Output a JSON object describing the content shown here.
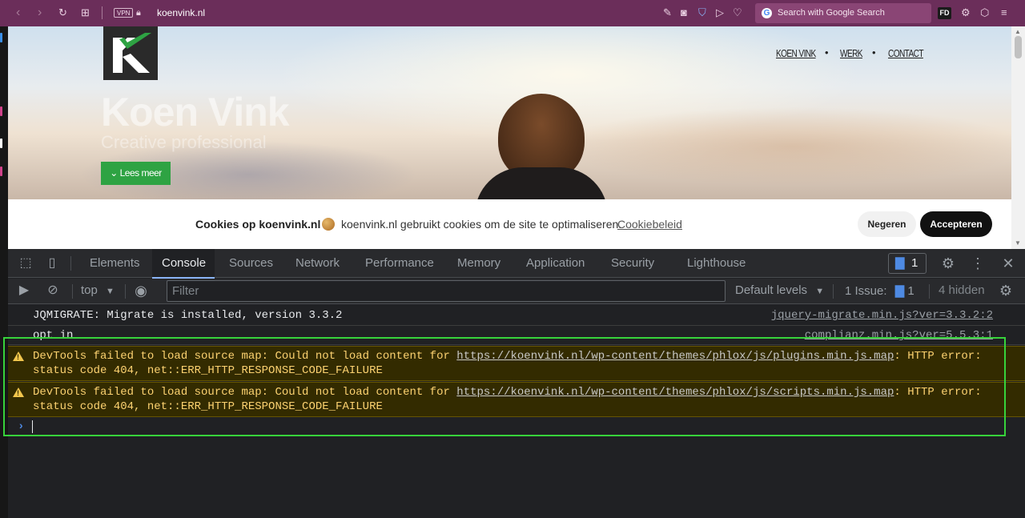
{
  "browser": {
    "url": "koenvink.nl",
    "vpn_label": "VPN",
    "search_placeholder": "Search with Google Search",
    "profile_badge": "FD",
    "nav_icons": [
      "back-icon",
      "forward-icon",
      "reload-icon",
      "tabs-grid-icon"
    ],
    "action_icons": [
      "edit-icon",
      "camera-icon",
      "shield-icon",
      "send-icon",
      "heart-icon",
      "settings-icon",
      "cube-icon",
      "menu-icon"
    ]
  },
  "site": {
    "hero_title": "Koen Vink",
    "hero_subtitle": "Creative professional",
    "cta_label": "Lees meer",
    "nav": [
      "KOEN VINK",
      "WERK",
      "CONTACT"
    ],
    "cookie": {
      "title": "Cookies op koenvink.nl",
      "text": "koenvink.nl gebruikt cookies om de site te optimaliseren.",
      "link": "Cookiebeleid",
      "decline": "Negeren",
      "accept": "Accepteren"
    }
  },
  "devtools": {
    "tabs": [
      "Elements",
      "Console",
      "Sources",
      "Network",
      "Performance",
      "Memory",
      "Application",
      "Security",
      "Lighthouse"
    ],
    "active_tab": "Console",
    "issues_count": "1",
    "context": "top",
    "filter_placeholder": "Filter",
    "levels": "Default levels",
    "issues_label": "1 Issue:",
    "issues_inline_count": "1",
    "hidden": "4 hidden",
    "logs": [
      {
        "message": "JQMIGRATE: Migrate is installed, version 3.3.2",
        "source": "jquery-migrate.min.js?ver=3.3.2:2"
      },
      {
        "message": "opt in",
        "source": "complianz.min.js?ver=5.5.3:1"
      }
    ],
    "warnings": [
      {
        "prefix": "DevTools failed to load source map: Could not load content for ",
        "url": "https://koenvink.nl/wp-content/themes/phlox/js/plugins.min.js.map",
        "suffix": ": HTTP error:",
        "line2": "status code 404, net::ERR_HTTP_RESPONSE_CODE_FAILURE"
      },
      {
        "prefix": "DevTools failed to load source map: Could not load content for ",
        "url": "https://koenvink.nl/wp-content/themes/phlox/js/scripts.min.js.map",
        "suffix": ": HTTP error:",
        "line2": "status code 404, net::ERR_HTTP_RESPONSE_CODE_FAILURE"
      }
    ],
    "prompt_symbol": "›"
  },
  "colors": {
    "browser_bar": "#6b2e5a",
    "devtools_bg": "#202124",
    "warning_bg": "#332b00",
    "warning_text": "#fcd271",
    "highlight": "#37d33b",
    "cta_green": "#2ea343"
  }
}
